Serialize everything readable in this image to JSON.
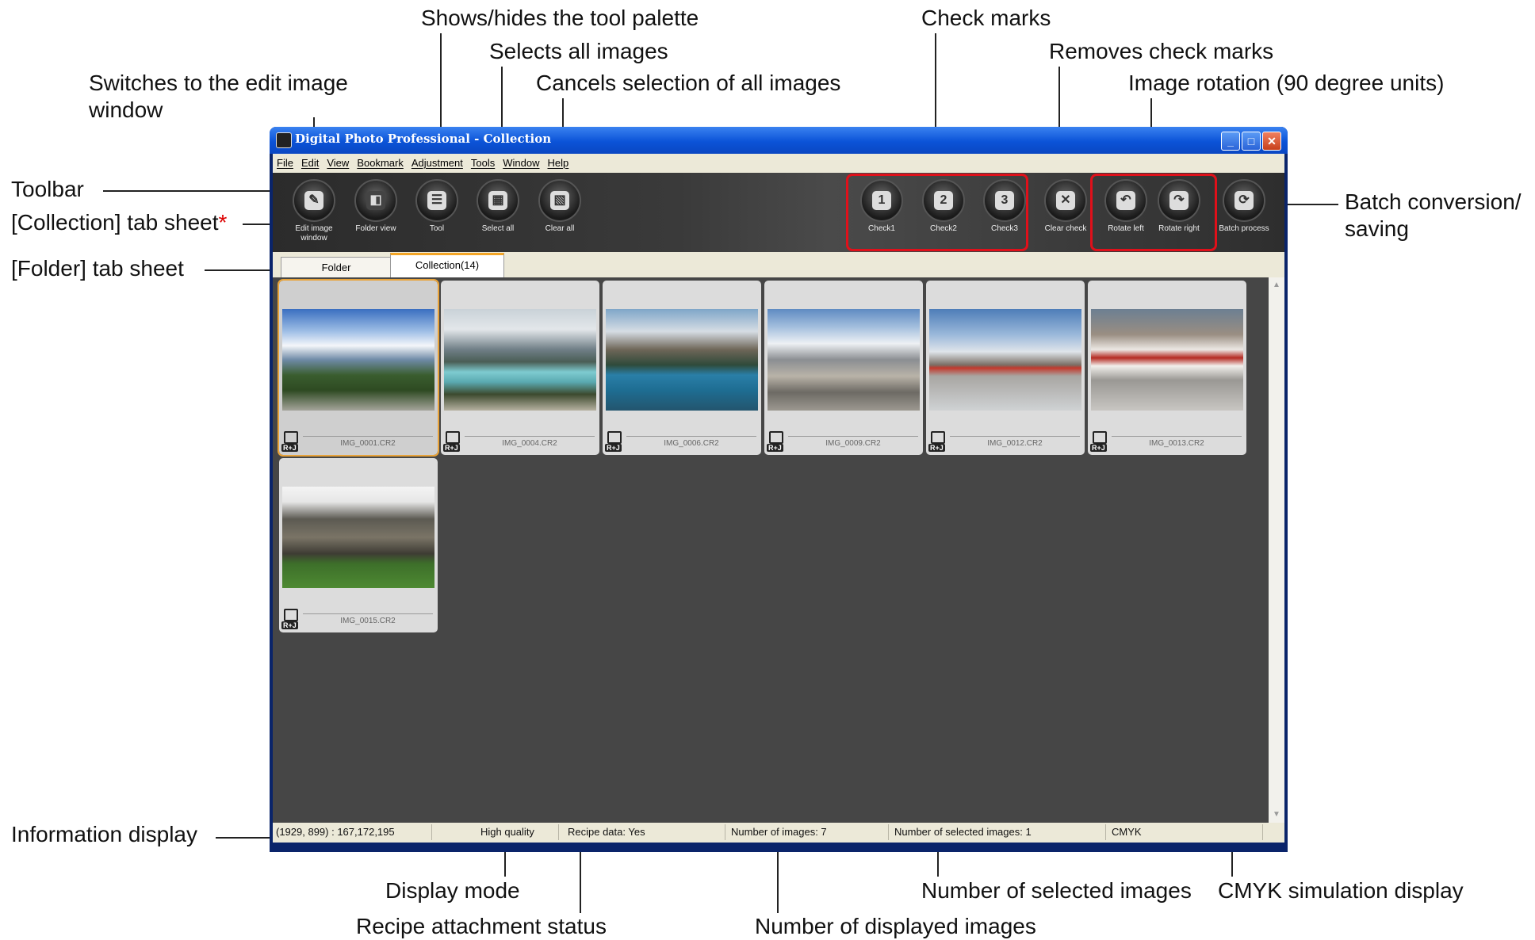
{
  "window": {
    "title": "Digital Photo Professional - Collection",
    "minimize": "_",
    "maximize": "□",
    "close": "✕"
  },
  "menu": [
    "File",
    "Edit",
    "View",
    "Bookmark",
    "Adjustment",
    "Tools",
    "Window",
    "Help"
  ],
  "toolbar": {
    "edit_image_window": "Edit image window",
    "folder_view": "Folder view",
    "tool": "Tool",
    "select_all": "Select all",
    "clear_all": "Clear all",
    "check1": "Check1",
    "check2": "Check2",
    "check3": "Check3",
    "clear_check": "Clear check",
    "rotate_left": "Rotate left",
    "rotate_right": "Rotate right",
    "batch_process": "Batch process"
  },
  "tabs": {
    "folder": "Folder",
    "collection": "Collection(14)"
  },
  "thumbnails": [
    {
      "name": "IMG_0001.CR2",
      "badge": "R+J"
    },
    {
      "name": "IMG_0004.CR2",
      "badge": "R+J"
    },
    {
      "name": "IMG_0006.CR2",
      "badge": "R+J"
    },
    {
      "name": "IMG_0009.CR2",
      "badge": "R+J"
    },
    {
      "name": "IMG_0012.CR2",
      "badge": "R+J"
    },
    {
      "name": "IMG_0013.CR2",
      "badge": "R+J"
    },
    {
      "name": "IMG_0015.CR2",
      "badge": "R+J"
    }
  ],
  "status": {
    "info": "(1929, 899) : 167,172,195",
    "display_mode": "High quality",
    "recipe": "Recipe data: Yes",
    "num_images": "Number of images: 7",
    "num_selected": "Number of selected images: 1",
    "cmyk": "CMYK"
  },
  "annotations": {
    "shows_hides_tool": "Shows/hides the tool palette",
    "selects_all": "Selects all images",
    "cancels_selection": "Cancels selection of all images",
    "switches_edit_1": "Switches to the edit image",
    "switches_edit_2": "window",
    "check_marks": "Check marks",
    "removes_check": "Removes check marks",
    "image_rotation": "Image rotation (90 degree units)",
    "toolbar": "Toolbar",
    "collection_tab": "[Collection] tab sheet",
    "collection_star": "*",
    "folder_tab": "[Folder] tab sheet",
    "batch_1": "Batch conversion/",
    "batch_2": "saving",
    "information_display": "Information display",
    "display_mode": "Display mode",
    "recipe_status": "Recipe attachment status",
    "num_selected": "Number of selected images",
    "cmyk_display": "CMYK simulation display",
    "num_displayed": "Number of displayed images"
  },
  "colors": {
    "highlight_box": "#e0101a",
    "selected_outline": "#e8a33a",
    "title_bar": "#0b53d8"
  }
}
